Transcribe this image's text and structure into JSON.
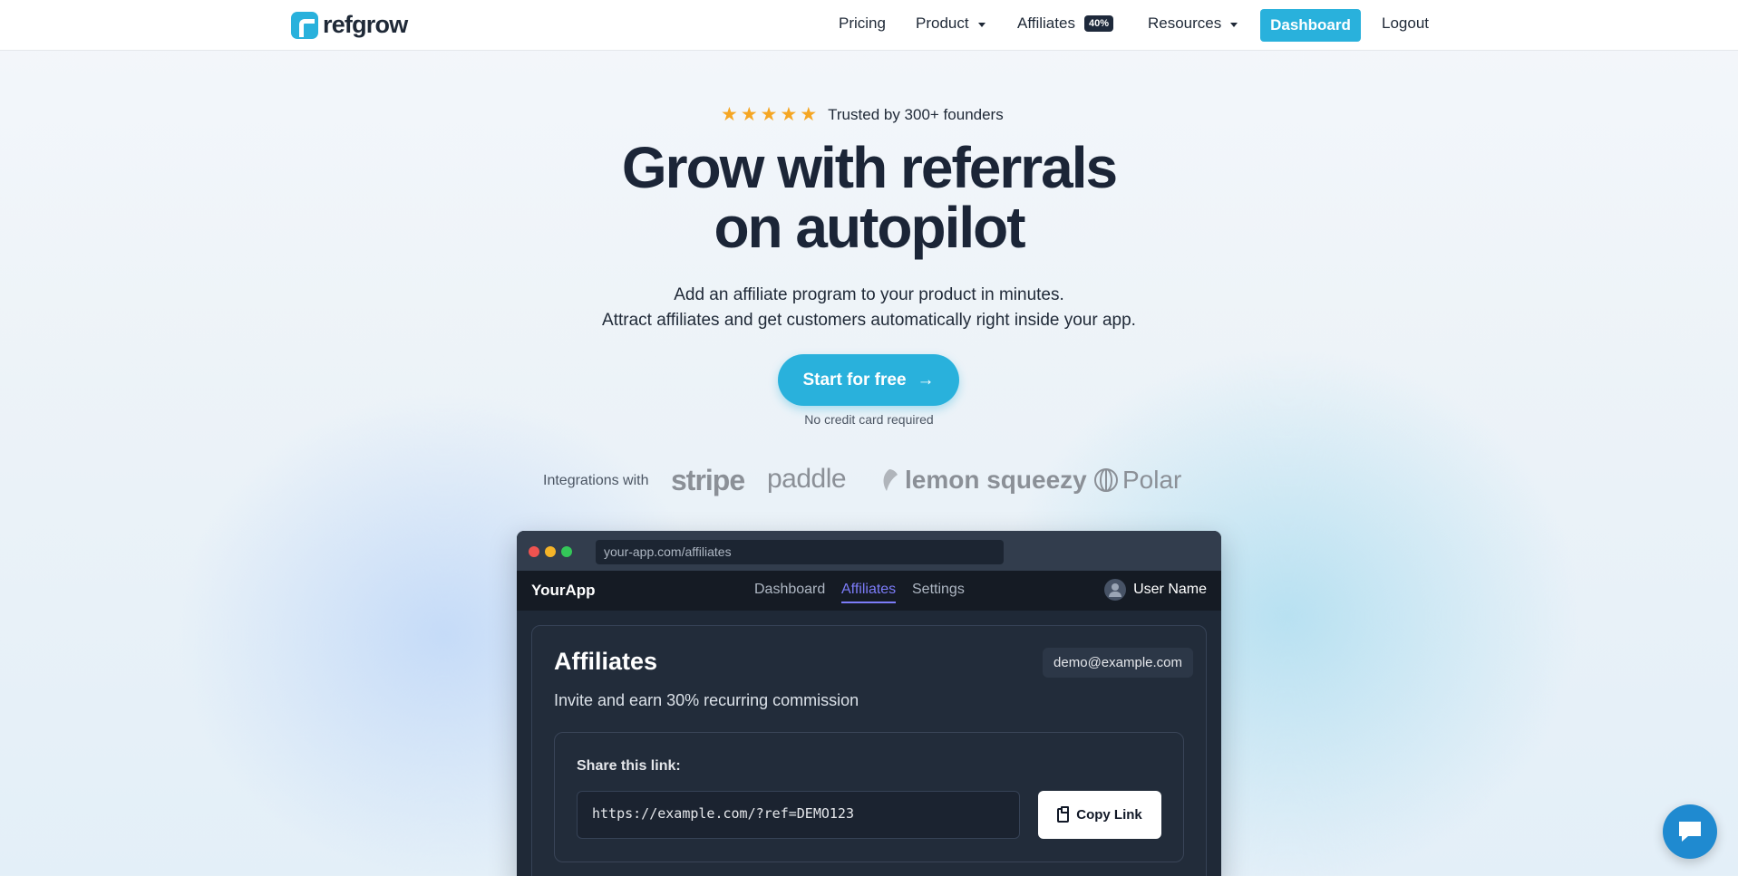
{
  "nav": {
    "brand": "refgrow",
    "links": {
      "pricing": "Pricing",
      "product": "Product",
      "affiliates": "Affiliates",
      "affiliates_badge": "40%",
      "resources": "Resources",
      "dashboard": "Dashboard",
      "logout": "Logout"
    }
  },
  "hero": {
    "rating_stars": 5,
    "trusted": "Trusted by 300+ founders",
    "headline_line1": "Grow with referrals",
    "headline_line2": "on autopilot",
    "sub_line1": "Add an affiliate program to your product in minutes.",
    "sub_line2": "Attract affiliates and get customers automatically right inside your app.",
    "cta": "Start for free",
    "cta_note": "No credit card required"
  },
  "integrations": {
    "label": "Integrations with",
    "logos": [
      "stripe",
      "paddle",
      "lemon squeezy",
      "Polar"
    ]
  },
  "mockup": {
    "url": "your-app.com/affiliates",
    "app_name": "YourApp",
    "tabs": [
      "Dashboard",
      "Affiliates",
      "Settings"
    ],
    "active_tab": "Affiliates",
    "user_name": "User Name",
    "title": "Affiliates",
    "subtitle": "Invite and earn 30% recurring commission",
    "email": "demo@example.com",
    "share_label": "Share this link:",
    "share_link": "https://example.com/?ref=DEMO123",
    "copy_button": "Copy Link"
  },
  "colors": {
    "brand": "#29b1dc",
    "star": "#f5a623",
    "active_tab": "#7c7cf8"
  }
}
